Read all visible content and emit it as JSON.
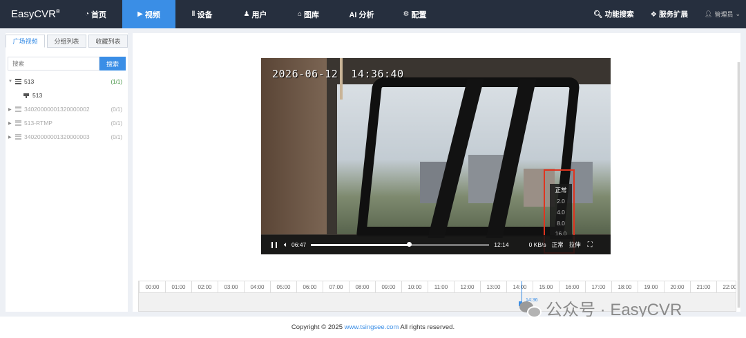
{
  "app": {
    "logo": "EasyCVR",
    "logo_mark": "®"
  },
  "nav": {
    "items": [
      {
        "label": "首页",
        "icon": "dashboard-icon",
        "active": false
      },
      {
        "label": "视频",
        "icon": "play-circle-icon",
        "active": true
      },
      {
        "label": "设备",
        "icon": "device-icon",
        "active": false
      },
      {
        "label": "用户",
        "icon": "user-icon",
        "active": false
      },
      {
        "label": "图库",
        "icon": "gallery-icon",
        "active": false
      },
      {
        "label": "AI 分析",
        "icon": "",
        "active": false
      },
      {
        "label": "配置",
        "icon": "gear-icon",
        "active": false
      }
    ],
    "right": {
      "search_label": "功能搜索",
      "extend_label": "服务扩展",
      "user_label": "管理员"
    }
  },
  "sidebar": {
    "tabs": [
      {
        "label": "广场视频",
        "active": true
      },
      {
        "label": "分组列表",
        "active": false
      },
      {
        "label": "收藏列表",
        "active": false
      }
    ],
    "search": {
      "placeholder": "搜索",
      "button": "搜索"
    },
    "tree": [
      {
        "name": "513",
        "count": "(1/1)",
        "online": true,
        "expanded": true
      },
      {
        "name": "513",
        "child": true
      },
      {
        "name": "34020000001320000002",
        "count": "(0/1)",
        "online": false
      },
      {
        "name": "513-RTMP",
        "count": "(0/1)",
        "online": false
      },
      {
        "name": "34020000001320000003",
        "count": "(0/1)",
        "online": false
      }
    ]
  },
  "player": {
    "osd_time": "2026-06-12  14:36:40",
    "current_time": "06:47",
    "duration": "12:14",
    "progress_fraction": 0.55,
    "bitrate": "0 KB/s",
    "speed_label": "正常",
    "stretch_label": "拉伸",
    "speed_options": [
      {
        "label": "正常",
        "selected": true
      },
      {
        "label": "2.0",
        "selected": false
      },
      {
        "label": "4.0",
        "selected": false
      },
      {
        "label": "8.0",
        "selected": false
      },
      {
        "label": "16.0",
        "selected": false
      }
    ],
    "highlight_color": "#e0341f"
  },
  "timeline": {
    "hours": [
      "00:00",
      "01:00",
      "02:00",
      "03:00",
      "04:00",
      "05:00",
      "06:00",
      "07:00",
      "08:00",
      "09:00",
      "10:00",
      "11:00",
      "12:00",
      "13:00",
      "14:00",
      "15:00",
      "16:00",
      "17:00",
      "18:00",
      "19:00",
      "20:00",
      "21:00",
      "22:00"
    ],
    "marker_label": "14:36"
  },
  "watermark": {
    "text": "公众号 · EasyCVR"
  },
  "footer": {
    "prefix": "Copyright © 2025 ",
    "link": "www.tsingsee.com",
    "suffix": " All rights reserved."
  },
  "colors": {
    "accent": "#3a8ee6",
    "nav_bg": "#262f3e",
    "online": "#3c8f3c"
  }
}
